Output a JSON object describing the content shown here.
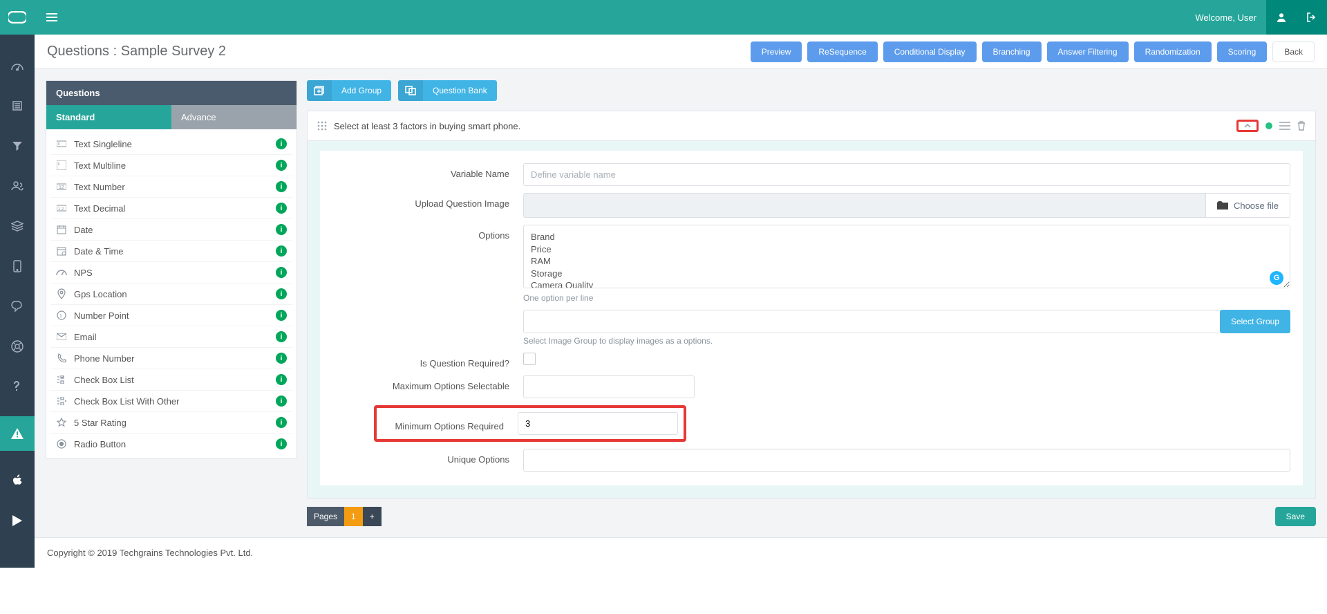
{
  "topnav": {
    "welcome": "Welcome, User"
  },
  "page": {
    "title": "Questions : Sample Survey 2",
    "actions": {
      "preview": "Preview",
      "resequence": "ReSequence",
      "conditional": "Conditional Display",
      "branching": "Branching",
      "filtering": "Answer Filtering",
      "random": "Randomization",
      "scoring": "Scoring",
      "back": "Back"
    }
  },
  "qpanel": {
    "head": "Questions",
    "tab_standard": "Standard",
    "tab_advance": "Advance",
    "types": [
      "Text Singleline",
      "Text Multiline",
      "Text Number",
      "Text Decimal",
      "Date",
      "Date & Time",
      "NPS",
      "Gps Location",
      "Number Point",
      "Email",
      "Phone Number",
      "Check Box List",
      "Check Box List With Other",
      "5 Star Rating",
      "Radio Button"
    ],
    "info_badge": "i"
  },
  "groupbar": {
    "add_group": "Add Group",
    "qbank": "Question Bank"
  },
  "question": {
    "title": "Select at least 3 factors in buying smart phone.",
    "labels": {
      "var_name": "Variable Name",
      "upload": "Upload Question Image",
      "options": "Options",
      "options_hint": "One option per line",
      "sel_group_hint": "Select Image Group to display images as a options.",
      "required": "Is Question Required?",
      "max_sel": "Maximum Options Selectable",
      "min_req": "Minimum Options Required",
      "unique": "Unique Options"
    },
    "placeholders": {
      "var_name": "Define variable name"
    },
    "choose_file": "Choose file",
    "options_value": "Brand\nPrice\nRAM\nStorage\nCamera Quality",
    "select_group_btn": "Select Group",
    "min_req_value": "3",
    "g_badge": "G"
  },
  "bottom": {
    "pages_label": "Pages",
    "page1": "1",
    "add": "+",
    "save": "Save"
  },
  "footer": "Copyright © 2019 Techgrains Technologies Pvt. Ltd."
}
